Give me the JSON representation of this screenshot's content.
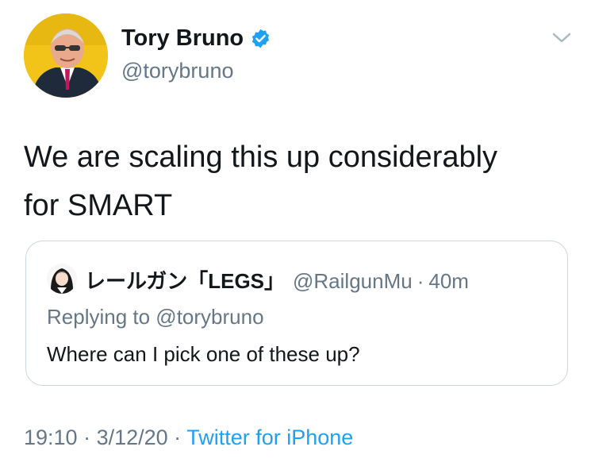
{
  "author": {
    "name": "Tory Bruno",
    "handle": "@torybruno",
    "verified": true,
    "avatar_icon": "profile-photo"
  },
  "tweet": {
    "text_line1": "We are scaling this up considerably",
    "text_line2": "for SMART"
  },
  "quoted": {
    "name": "レールガン「LEGS」",
    "handle": "@RailgunMu",
    "separator": "·",
    "time": "40m",
    "replying_to": "Replying to @torybruno",
    "text": "Where can I pick one of these up?",
    "avatar_icon": "anime-avatar"
  },
  "meta": {
    "time": "19:10",
    "sep1": " · ",
    "date": "3/12/20",
    "sep2": " · ",
    "source": "Twitter for iPhone"
  },
  "colors": {
    "accent": "#1da1f2",
    "muted": "#657786",
    "text": "#14171a",
    "border": "#ccd6dd"
  }
}
